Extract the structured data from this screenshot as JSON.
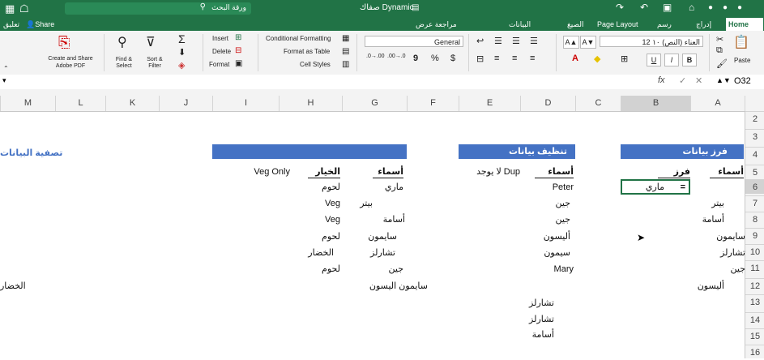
{
  "titlebar": {
    "title": "صفاك Dynamic",
    "search_placeholder": "ورقة البحث",
    "share_label": "Share",
    "comments_label": "تعليق"
  },
  "tabs": [
    {
      "label": "Home",
      "active": true
    },
    {
      "label": "إدراج"
    },
    {
      "label": "رسم"
    },
    {
      "label": "Page Layout"
    },
    {
      "label": "الصيغ"
    },
    {
      "label": "البيانات"
    },
    {
      "label": "مراجعة عرض"
    }
  ],
  "ribbon": {
    "paste_label": "Paste",
    "font_name": "العناء (النص) ۱۰ 12",
    "bold": "B",
    "italic": "I",
    "underline": "U",
    "font_grow": "A▲",
    "font_shrink": "A▼",
    "number_format": "General",
    "currency": "$",
    "percent": "%",
    "comma": "9",
    "dec_inc": ".00→.0",
    "dec_dec": ".0→.00",
    "conditional_formatting": "Conditional Formatting",
    "format_as_table": "Format as Table",
    "cell_styles": "Cell Styles",
    "insert": "Insert",
    "delete": "Delete",
    "format": "Format",
    "sort_filter": "Sort & Filter",
    "find_select": "Find & Select",
    "create_share": "Create and Share Adobe PDF"
  },
  "formula_bar": {
    "name_box": "O32",
    "fx": "fx",
    "content": ""
  },
  "columns": [
    "A",
    "B",
    "C",
    "D",
    "E",
    "F",
    "G",
    "H",
    "I",
    "J",
    "K",
    "L",
    "M"
  ],
  "rows": [
    "2",
    "3",
    "4",
    "5",
    "6",
    "7",
    "8",
    "9",
    "10",
    "11",
    "12",
    "13",
    "14",
    "15",
    "16"
  ],
  "sections": {
    "sort_title": "فرز بيانات",
    "clean_title": "تنظيف بيانات",
    "third_title": "",
    "m_partial": "تصفية البيانات"
  },
  "sort_block": {
    "header_names": "أسماء",
    "header_sort": "فرز",
    "sort_cell_eq": "=",
    "sort_cell_val": "ماري",
    "names": [
      "بيتر",
      "أسامة",
      "سايمون",
      "تشارلز",
      "جين",
      "أليسون"
    ]
  },
  "clean_block": {
    "header_names": "أسماء",
    "no_dup": "لا يوجد Dup",
    "names": [
      "Peter",
      "جين",
      "جين",
      "أليسون",
      "سيمون",
      "Mary",
      "",
      "تشارلز",
      "تشارلز",
      "أسامة"
    ]
  },
  "filter_block": {
    "header_names": "أسماء",
    "header_option": "الخيار",
    "veg_only": "Veg Only",
    "names": [
      "ماري",
      "بيتر",
      "أسامة",
      "سايمون",
      "تشارلز",
      "جين",
      "سايمون اليسون"
    ],
    "options": [
      "لحوم",
      "Veg",
      "Veg",
      "لحوم",
      "الخضار",
      "لحوم",
      ""
    ],
    "m_value": "الخضار"
  },
  "colors": {
    "excel_green": "#217346",
    "header_blue": "#4472c4",
    "selection_green": "#217346"
  }
}
